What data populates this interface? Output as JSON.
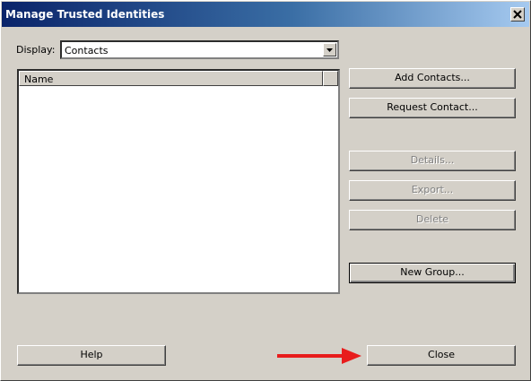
{
  "window": {
    "title": "Manage Trusted Identities"
  },
  "display": {
    "label": "Display:",
    "selected": "Contacts"
  },
  "list": {
    "column_name": "Name",
    "rows": []
  },
  "buttons": {
    "add_contacts": "Add Contacts...",
    "request_contact": "Request Contact...",
    "details": "Details...",
    "export": "Export...",
    "delete": "Delete",
    "new_group": "New Group...",
    "help": "Help",
    "close": "Close"
  },
  "annotation": {
    "arrow_color": "#e81c1c"
  }
}
